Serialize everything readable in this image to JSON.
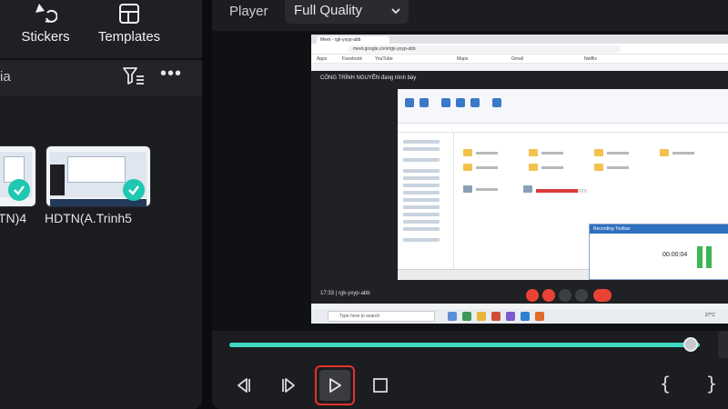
{
  "toolbar": {
    "stickers_label": "Stickers",
    "templates_label": "Templates"
  },
  "media": {
    "header_label": "ia",
    "items": [
      {
        "caption": "TN)4",
        "selected": true
      },
      {
        "caption": "HDTN(A.Trinh5",
        "selected": true
      }
    ]
  },
  "player": {
    "label": "Player",
    "quality": "Full Quality"
  },
  "preview": {
    "browser_tab": "Meet - rgk-yxyp-abb",
    "address": "meet.google.com/rgk-yxyp-abb",
    "bookmarks": [
      "Apps",
      "Facebook",
      "YouTube",
      "Maps",
      "Gmail",
      "Netflix"
    ],
    "presenting_label": "CÔNG TRÌNH NGUYỄN đang trình bày",
    "recorder_title": "Recording Toolbar",
    "recorder_time": "00:00:04",
    "meeting_time": "17:33",
    "meeting_code": "rgk-yxyp-abb",
    "os_search": "Type here to search",
    "os_clock": "27°C"
  },
  "timeline": {
    "progress": 0.98
  },
  "controls": {
    "mark_in": "{",
    "mark_out": "}"
  },
  "colors": {
    "accent": "#3ed9c2",
    "check": "#1ec8b2",
    "highlight": "#e4312e"
  }
}
